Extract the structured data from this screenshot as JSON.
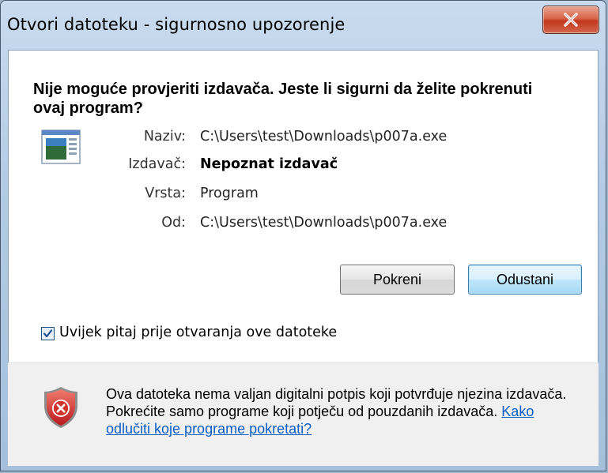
{
  "window": {
    "title": "Otvori datoteku - sigurnosno upozorenje",
    "close_glyph": "x"
  },
  "warning": {
    "heading": "Nije moguće provjeriti izdavača. Jeste li sigurni da želite pokrenuti ovaj program?"
  },
  "details": [
    {
      "label": "Naziv:",
      "value": "C:\\Users\\test\\Downloads\\p007a.exe",
      "bold": false
    },
    {
      "label": "Izdavač:",
      "value": "Nepoznat izdavač",
      "bold": true
    },
    {
      "label": "Vrsta:",
      "value": "Program",
      "bold": false
    },
    {
      "label": "Od:",
      "value": "C:\\Users\\test\\Downloads\\p007a.exe",
      "bold": false
    }
  ],
  "buttons": {
    "run": "Pokreni",
    "cancel": "Odustani"
  },
  "checkbox": {
    "label": "Uvijek pitaj prije otvaranja ove datoteke",
    "checked": true
  },
  "footer": {
    "text": "Ova datoteka nema valjan digitalni potpis koji potvrđuje njezina izdavača. Pokrećite samo programe koji potječu od pouzdanih izdavača. ",
    "link": "Kako odlučiti koje programe pokretati?"
  },
  "icons": {
    "program": "program-file-icon",
    "shield": "security-shield-icon",
    "close": "close-icon",
    "check": "checkmark-icon"
  },
  "colors": {
    "link": "#0b5ec4",
    "close_button": "#c2361d",
    "shield_red": "#d2322a"
  }
}
